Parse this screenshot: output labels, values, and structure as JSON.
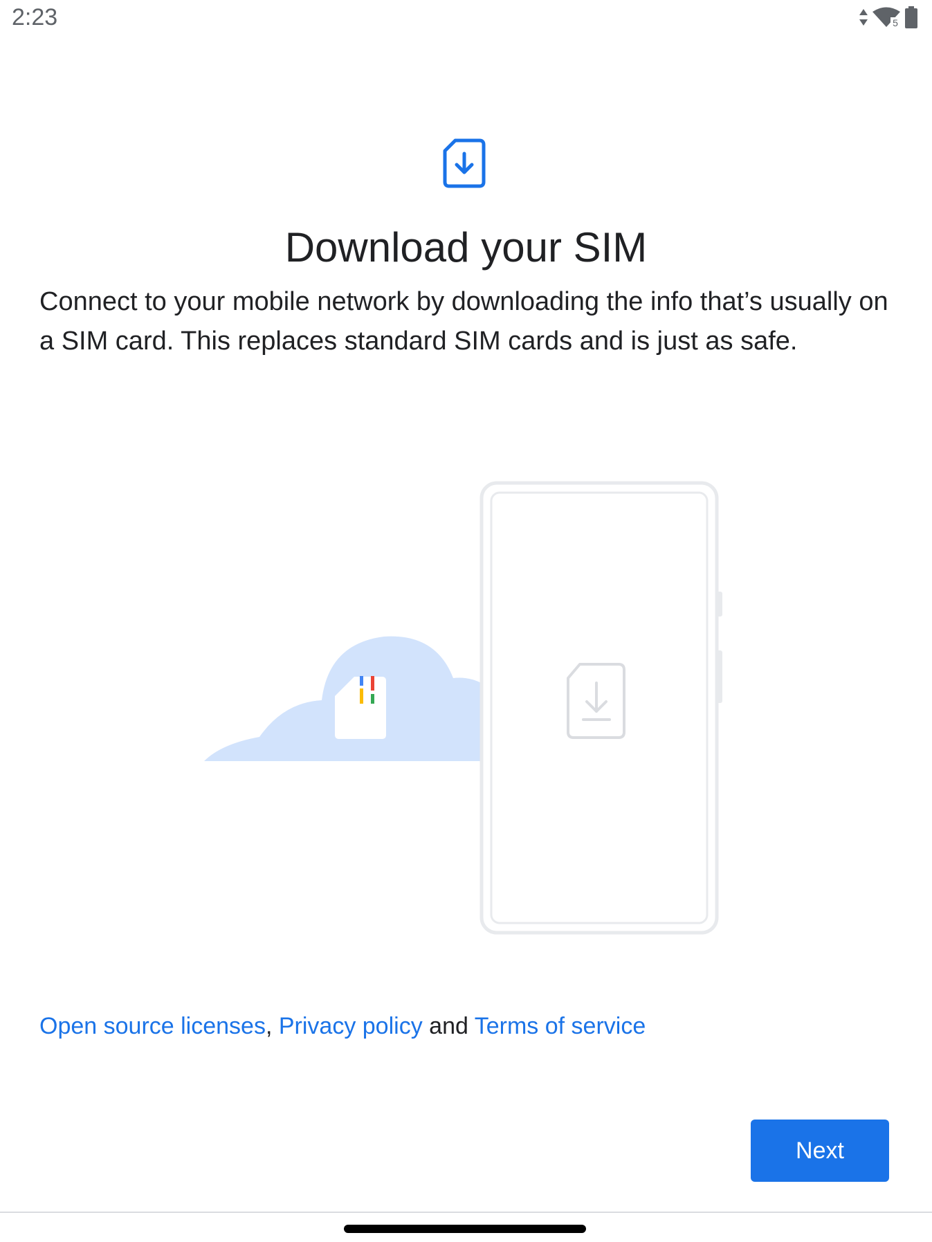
{
  "status_bar": {
    "time": "2:23",
    "icons": [
      "data-arrows-icon",
      "wifi-icon",
      "battery-icon"
    ],
    "wifi_badge": "5"
  },
  "header": {
    "icon": "sim-download-icon",
    "title": "Download your SIM"
  },
  "body": {
    "description": "Connect to your mobile network by downloading the info that’s usually on a SIM card. This replaces standard SIM cards and is just as safe."
  },
  "illustration": {
    "elements": [
      "cloud",
      "sim-card",
      "phone",
      "sim-download-icon"
    ],
    "sim_stripe_colors": [
      "#4285F4",
      "#EA4335",
      "#FBBC04",
      "#34A853"
    ]
  },
  "legal": {
    "open_source_label": "Open source licenses",
    "comma": ",",
    "privacy_label": "Privacy policy",
    "and_text": "and",
    "terms_label": "Terms of service"
  },
  "actions": {
    "next_label": "Next"
  },
  "colors": {
    "accent": "#1a73e8",
    "text_primary": "#202124",
    "cloud": "#d2e3fc"
  }
}
